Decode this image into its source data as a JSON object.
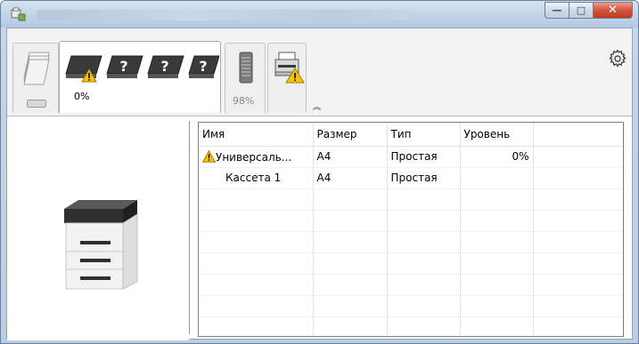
{
  "window": {
    "title": "",
    "controls": {
      "minimize": "—",
      "maximize": "□",
      "close": "✕"
    }
  },
  "tabs": [
    {
      "name": "toner",
      "caption": "",
      "icon": "toner-stack-icon"
    },
    {
      "name": "trays",
      "caption": "0%",
      "icon": "paper-trays-icon",
      "status": "warning"
    },
    {
      "name": "output",
      "caption": "98%",
      "icon": "waste-toner-icon"
    },
    {
      "name": "device",
      "caption": "",
      "icon": "printer-warning-icon",
      "status": "warning"
    }
  ],
  "collapse_glyph": "︽",
  "list": {
    "columns": [
      "Имя",
      "Размер",
      "Тип",
      "Уровень"
    ],
    "rows": [
      {
        "name": "Универсаль...",
        "size": "A4",
        "type": "Простая",
        "level": "0%",
        "warning": true
      },
      {
        "name": "Кассета 1",
        "size": "A4",
        "type": "Простая",
        "level": "",
        "warning": false
      }
    ]
  },
  "colors": {
    "warning": "#f5c400",
    "title_bar": "#c3d5ea",
    "close_button": "#d2543b"
  }
}
